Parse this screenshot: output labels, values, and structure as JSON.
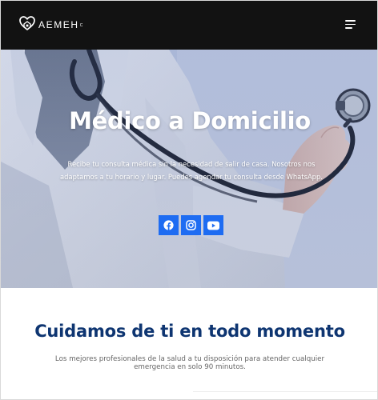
{
  "header": {
    "logo_text": "AEMEH",
    "logo_suffix": "C",
    "logo_icon": "heart-house-icon",
    "menu_icon": "hamburger-menu-icon"
  },
  "hero": {
    "title": "Médico a Domicilio",
    "description": "Recibe tu consulta médica sin la necesidad de salir de casa. Nosotros nos adaptamos a tu horario y lugar. Puedes agendar tu consulta desde WhatsApp.",
    "social": [
      {
        "icon": "facebook-icon"
      },
      {
        "icon": "instagram-icon"
      },
      {
        "icon": "youtube-icon"
      }
    ]
  },
  "section": {
    "title": "Cuidamos de ti en todo momento",
    "text": "Los mejores profesionales de la salud a tu disposición para atender cualquier emergencia en solo 90 minutos."
  },
  "colors": {
    "header_bg": "#121212",
    "social_bg": "#1e6cf2",
    "section_title": "#0e3571",
    "section_text": "#666666"
  }
}
